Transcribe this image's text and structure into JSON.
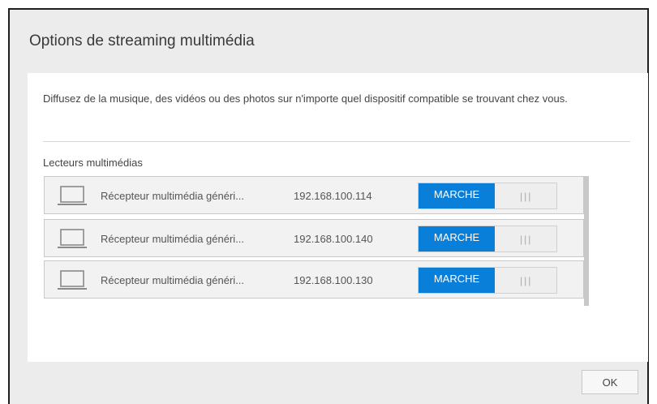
{
  "dialog": {
    "title": "Options de streaming multimédia",
    "description": "Diffusez de la musique, des vidéos ou des photos sur n'importe quel dispositif compatible se trouvant chez vous.",
    "section_label": "Lecteurs multimédias",
    "ok_label": "OK"
  },
  "players": [
    {
      "icon": "laptop-icon",
      "name": "Récepteur multimédia généri...",
      "ip": "192.168.100.114",
      "toggle_label": "MARCHE",
      "toggle_grip": "|||"
    },
    {
      "icon": "laptop-icon",
      "name": "Récepteur multimédia généri...",
      "ip": "192.168.100.140",
      "toggle_label": "MARCHE",
      "toggle_grip": "|||"
    },
    {
      "icon": "laptop-icon",
      "name": "Récepteur multimédia généri...",
      "ip": "192.168.100.130",
      "toggle_label": "MARCHE",
      "toggle_grip": "|||"
    }
  ],
  "colors": {
    "toggle_on": "#0a7fd9",
    "dialog_background": "#ececec",
    "content_background": "#ffffff"
  }
}
